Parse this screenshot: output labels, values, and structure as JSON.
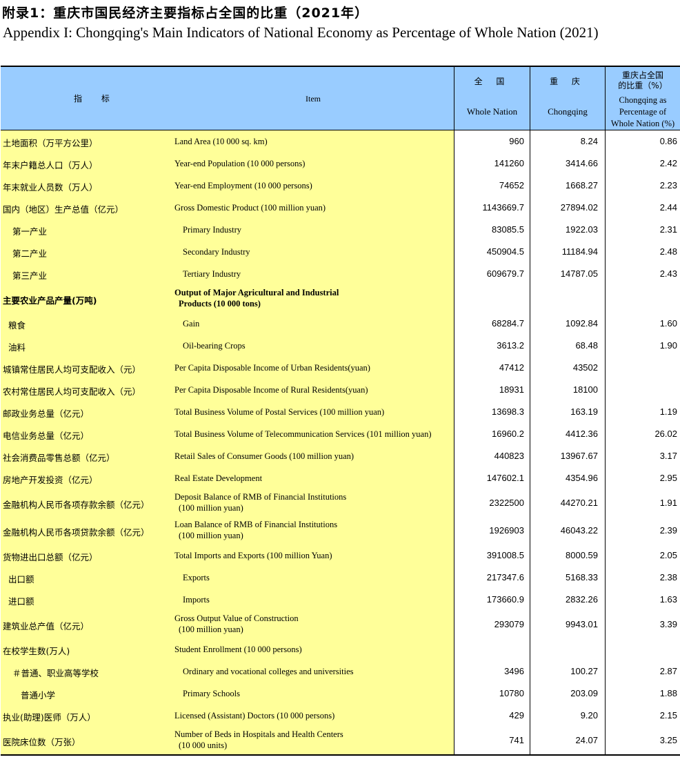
{
  "title_cn": "附录1：重庆市国民经济主要指标占全国的比重（2021年）",
  "title_en": "Appendix I: Chongqing's Main Indicators of National Economy as Percentage of Whole Nation (2021)",
  "header": {
    "indicator_zh": "指 标",
    "item_en": "Item",
    "nation_zh": "全 国",
    "nation_en": "Whole Nation",
    "cq_zh": "重 庆",
    "cq_en": "Chongqing",
    "pct_zh_1": "重庆占全国",
    "pct_zh_2": "的比重（%）",
    "pct_en_1": "Chongqing as",
    "pct_en_2": "Percentage of",
    "pct_en_3": "Whole Nation (%)"
  },
  "rows": [
    {
      "zh": "土地面积（万平方公里）",
      "en1": "Land Area (10 000 sq. km)",
      "en2": "",
      "nation": "960",
      "cq": "8.24",
      "pct": "0.86"
    },
    {
      "zh": "年末户籍总人口（万人）",
      "en1": "Year-end Population (10 000 persons)",
      "en2": "",
      "nation": "141260",
      "cq": "3414.66",
      "pct": "2.42"
    },
    {
      "zh": "年末就业人员数（万人）",
      "en1": "Year-end Employment (10 000 persons)",
      "en2": "",
      "nation": "74652",
      "cq": "1668.27",
      "pct": "2.23"
    },
    {
      "zh": "国内（地区）生产总值（亿元）",
      "en1": "Gross Domestic Product (100 million yuan)",
      "en2": "",
      "nation": "1143669.7",
      "cq": "27894.02",
      "pct": "2.44"
    },
    {
      "zh": "第一产业",
      "en1": "Primary Industry",
      "en2": "",
      "nation": "83085.5",
      "cq": "1922.03",
      "pct": "2.31"
    },
    {
      "zh": "第二产业",
      "en1": "Secondary Industry",
      "en2": "",
      "nation": "450904.5",
      "cq": "11184.94",
      "pct": "2.48"
    },
    {
      "zh": "第三产业",
      "en1": "Tertiary Industry",
      "en2": "",
      "nation": "609679.7",
      "cq": "14787.05",
      "pct": "2.43"
    },
    {
      "zh": "主要农业产品产量(万吨)",
      "en1": "Output of Major Agricultural and Industrial",
      "en2": "Products (10 000 tons)",
      "nation": "",
      "cq": "",
      "pct": ""
    },
    {
      "zh": "粮食",
      "en1": "Gain",
      "en2": "",
      "nation": "68284.7",
      "cq": "1092.84",
      "pct": "1.60"
    },
    {
      "zh": "油料",
      "en1": "Oil-bearing Crops",
      "en2": "",
      "nation": "3613.2",
      "cq": "68.48",
      "pct": "1.90"
    },
    {
      "zh": "城镇常住居民人均可支配收入（元）",
      "en1": "Per Capita Disposable Income of Urban Residents(yuan)",
      "en2": "",
      "nation": "47412",
      "cq": "43502",
      "pct": ""
    },
    {
      "zh": "农村常住居民人均可支配收入（元）",
      "en1": "Per Capita Disposable Income of Rural Residents(yuan)",
      "en2": "",
      "nation": "18931",
      "cq": "18100",
      "pct": ""
    },
    {
      "zh": "邮政业务总量（亿元）",
      "en1": "Total Business Volume of Postal Services (100 million yuan)",
      "en2": "",
      "nation": "13698.3",
      "cq": "163.19",
      "pct": "1.19"
    },
    {
      "zh": "电信业务总量（亿元）",
      "en1": "Total Business Volume of Telecommunication Services (101 million yuan)",
      "en2": "",
      "nation": "16960.2",
      "cq": "4412.36",
      "pct": "26.02"
    },
    {
      "zh": "社会消费品零售总额（亿元）",
      "en1": "Retail Sales of Consumer Goods (100 million yuan)",
      "en2": "",
      "nation": "440823",
      "cq": "13967.67",
      "pct": "3.17"
    },
    {
      "zh": "房地产开发投资（亿元）",
      "en1": "Real Estate Development",
      "en2": "",
      "nation": "147602.1",
      "cq": "4354.96",
      "pct": "2.95"
    },
    {
      "zh": "金融机构人民币各项存款余额（亿元）",
      "en1": "Deposit Balance of RMB of Financial Institutions",
      "en2": "(100 million yuan)",
      "nation": "2322500",
      "cq": "44270.21",
      "pct": "1.91"
    },
    {
      "zh": "金融机构人民币各项贷款余额（亿元）",
      "en1": "Loan Balance of RMB of Financial Institutions",
      "en2": "(100 million yuan)",
      "nation": "1926903",
      "cq": "46043.22",
      "pct": "2.39"
    },
    {
      "zh": "货物进出口总额（亿元）",
      "en1": "Total Imports and Exports (100 million Yuan)",
      "en2": "",
      "nation": "391008.5",
      "cq": "8000.59",
      "pct": "2.05"
    },
    {
      "zh": "出口额",
      "en1": "Exports",
      "en2": "",
      "nation": "217347.6",
      "cq": "5168.33",
      "pct": "2.38"
    },
    {
      "zh": "进口额",
      "en1": "Imports",
      "en2": "",
      "nation": "173660.9",
      "cq": "2832.26",
      "pct": "1.63"
    },
    {
      "zh": "建筑业总产值（亿元）",
      "en1": "Gross Output Value of Construction",
      "en2": "(100 million yuan)",
      "nation": "293079",
      "cq": "9943.01",
      "pct": "3.39"
    },
    {
      "zh": "在校学生数(万人)",
      "en1": "Student Enrollment  (10 000 persons)",
      "en2": "",
      "nation": "",
      "cq": "",
      "pct": ""
    },
    {
      "zh": "＃普通、职业高等学校",
      "en1": "Ordinary and vocational colleges and universities",
      "en2": "",
      "nation": "3496",
      "cq": "100.27",
      "pct": "2.87"
    },
    {
      "zh": "普通小学",
      "en1": "Primary Schools",
      "en2": "",
      "nation": "10780",
      "cq": "203.09",
      "pct": "1.88"
    },
    {
      "zh": "执业(助理)医师（万人）",
      "en1": "Licensed (Assistant) Doctors (10 000 persons)",
      "en2": "",
      "nation": "429",
      "cq": "9.20",
      "pct": "2.15"
    },
    {
      "zh": "医院床位数（万张）",
      "en1": "Number of Beds in Hospitals and Health Centers",
      "en2": "(10 000 units)",
      "nation": "741",
      "cq": "24.07",
      "pct": "3.25"
    }
  ]
}
